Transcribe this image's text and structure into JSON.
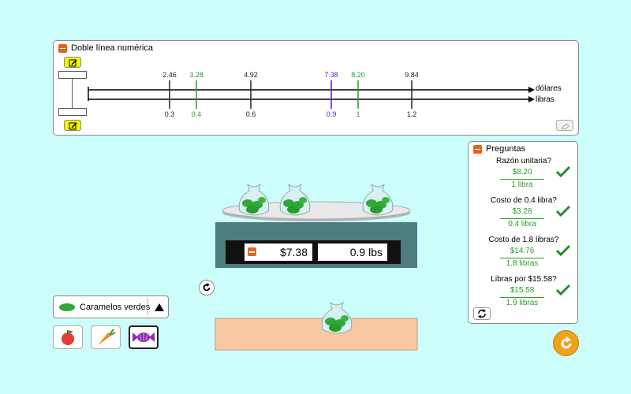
{
  "numberline": {
    "title": "Doble línea numérica",
    "top_label": "dólares",
    "bottom_label": "libras",
    "ticks": [
      {
        "top": "2.46",
        "bottom": "0.3",
        "color": "#222222"
      },
      {
        "top": "3.28",
        "bottom": "0.4",
        "color": "#2c9b2c"
      },
      {
        "top": "4.92",
        "bottom": "0.6",
        "color": "#222222"
      },
      {
        "top": "7.38",
        "bottom": "0.9",
        "color": "#2a2adf"
      },
      {
        "top": "8.20",
        "bottom": "1",
        "color": "#2c9b2c"
      },
      {
        "top": "9.84",
        "bottom": "1.2",
        "color": "#222222"
      }
    ]
  },
  "questions": {
    "title": "Preguntas",
    "items": [
      {
        "prompt": "Razón unitaria?",
        "top": "$8.20",
        "bottom": "1 libra"
      },
      {
        "prompt": "Costo de 0.4 libra?",
        "top": "$3.28",
        "bottom": "0.4 libra"
      },
      {
        "prompt": "Costo de 1.8 libras?",
        "top": "$14.76",
        "bottom": "1.8 libras"
      },
      {
        "prompt": "Libras por $15.58?",
        "top": "$15.58",
        "bottom": "1.9 libras"
      }
    ]
  },
  "scale": {
    "price": "$7.38",
    "weight": "0.9 lbs"
  },
  "selector": {
    "label": "Caramelos verdes"
  },
  "colors": {
    "background": "#ccfdfa",
    "accent": "#e8621f",
    "correct": "#2c9b2c",
    "scale_base": "#4d7d7e",
    "shelf": "#f7c8a2"
  }
}
